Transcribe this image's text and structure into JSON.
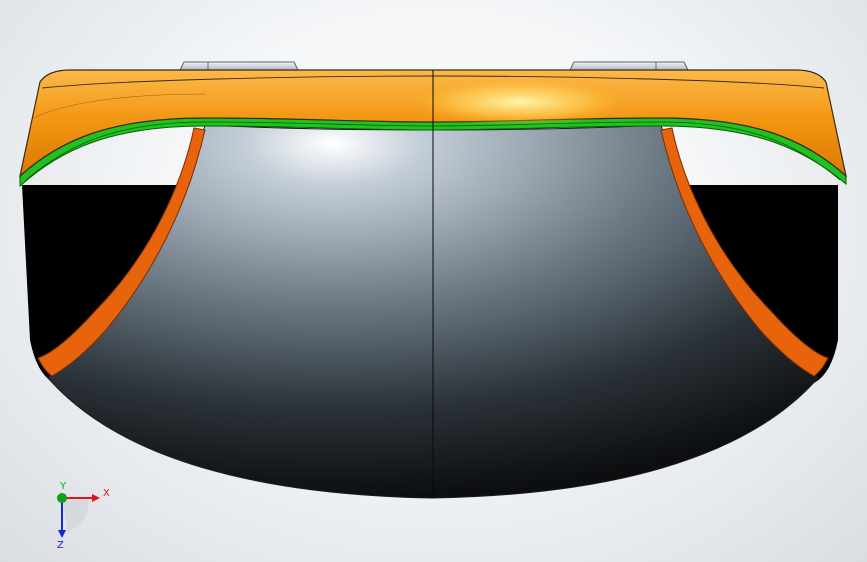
{
  "viewport": {
    "colors": {
      "background_center": "#ffffff",
      "background_edge": "#d9dee3",
      "shell_light": "#b9c6d2",
      "shell_dark": "#121416",
      "rim_orange": "#f59a13",
      "rim_highlight": "#fff6a8",
      "seal_green": "#1fc21f",
      "inner_cavity": "#000000",
      "trim_orange": "#e8640c",
      "tab_gray": "#d6dde4"
    }
  },
  "triad": {
    "x_label": "X",
    "y_label": "Y",
    "z_label": "Z",
    "x_color": "#e01414",
    "y_color": "#10a010",
    "z_color": "#1428d0"
  }
}
